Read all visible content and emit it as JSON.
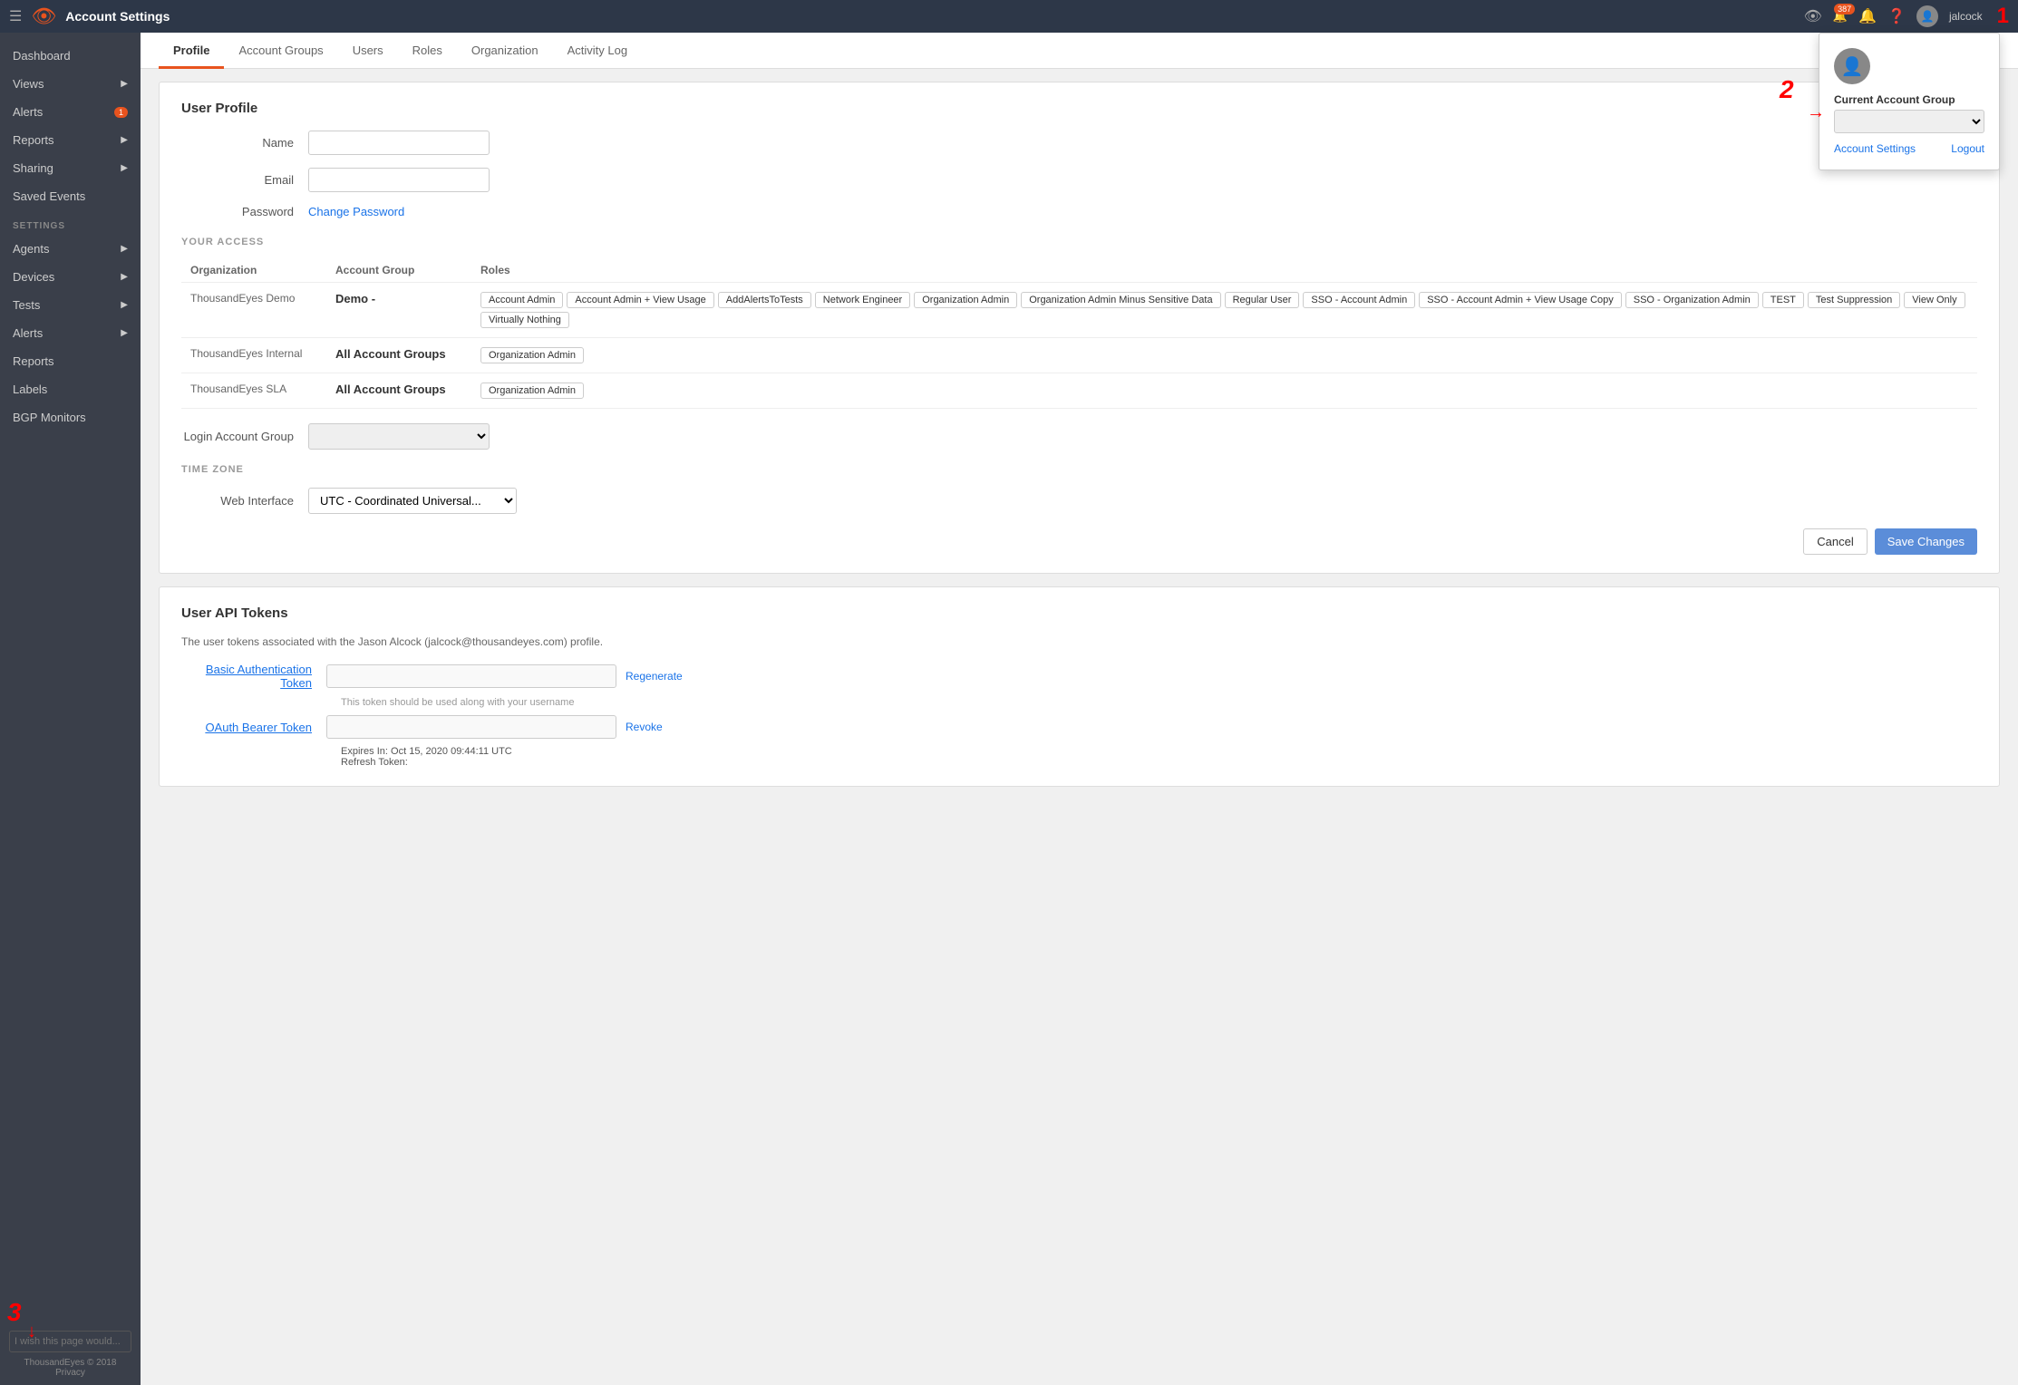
{
  "topNav": {
    "title": "Account Settings",
    "badgeCount": "387",
    "username": "jalcock"
  },
  "popup": {
    "label": "Current Account Group",
    "links": {
      "settings": "Account Settings",
      "logout": "Logout"
    }
  },
  "sidebar": {
    "topItems": [
      {
        "label": "Dashboard",
        "arrow": false
      },
      {
        "label": "Views",
        "arrow": true
      },
      {
        "label": "Alerts",
        "arrow": false,
        "badge": "1"
      },
      {
        "label": "Reports",
        "arrow": true
      },
      {
        "label": "Sharing",
        "arrow": true
      },
      {
        "label": "Saved Events",
        "arrow": false
      }
    ],
    "settingsSection": "SETTINGS",
    "settingsItems": [
      {
        "label": "Agents",
        "arrow": true
      },
      {
        "label": "Devices",
        "arrow": true
      },
      {
        "label": "Tests",
        "arrow": true
      },
      {
        "label": "Alerts",
        "arrow": true
      },
      {
        "label": "Reports",
        "arrow": false
      },
      {
        "label": "Labels",
        "arrow": false
      },
      {
        "label": "BGP Monitors",
        "arrow": false
      }
    ],
    "feedback": "I wish this page would...",
    "footer": "ThousandEyes © 2018",
    "privacy": "Privacy"
  },
  "tabs": [
    "Profile",
    "Account Groups",
    "Users",
    "Roles",
    "Organization",
    "Activity Log"
  ],
  "activeTab": "Profile",
  "userProfile": {
    "sectionTitle": "User Profile",
    "nameLabel": "Name",
    "emailLabel": "Email",
    "passwordLabel": "Password",
    "changePasswordText": "Change Password",
    "namePlaceholder": "",
    "emailPlaceholder": ""
  },
  "yourAccess": {
    "sectionTitle": "YOUR ACCESS",
    "columns": [
      "Organization",
      "Account Group",
      "Roles"
    ],
    "rows": [
      {
        "org": "ThousandEyes Demo",
        "accountGroup": "Demo -",
        "roles": [
          "Account Admin",
          "Account Admin + View Usage",
          "AddAlertsToTests",
          "Network Engineer",
          "Organization Admin",
          "Organization Admin Minus Sensitive Data",
          "Regular User",
          "SSO - Account Admin",
          "SSO - Account Admin + View Usage Copy",
          "SSO - Organization Admin",
          "TEST",
          "Test Suppression",
          "View Only",
          "Virtually Nothing"
        ]
      },
      {
        "org": "ThousandEyes Internal",
        "accountGroup": "All Account Groups",
        "roles": [
          "Organization Admin"
        ]
      },
      {
        "org": "ThousandEyes SLA",
        "accountGroup": "All Account Groups",
        "roles": [
          "Organization Admin"
        ]
      }
    ],
    "loginAccountGroupLabel": "Login Account Group",
    "timezoneSection": "TIME ZONE",
    "webInterfaceLabel": "Web Interface",
    "timezoneValue": "UTC - Coordinated Universal...",
    "cancelButton": "Cancel",
    "saveButton": "Save Changes"
  },
  "apiTokens": {
    "sectionTitle": "User API Tokens",
    "description": "The user tokens associated with the Jason Alcock (jalcock@thousandeyes.com) profile.",
    "basicAuthLabel": "Basic Authentication Token",
    "basicAuthHint": "This token should be used along with your username",
    "basicAuthAction": "Regenerate",
    "oauthLabel": "OAuth Bearer Token",
    "oauthAction": "Revoke",
    "expiresLabel": "Expires In:",
    "expiresValue": "Oct 15, 2020 09:44:11 UTC",
    "refreshLabel": "Refresh Token:"
  }
}
